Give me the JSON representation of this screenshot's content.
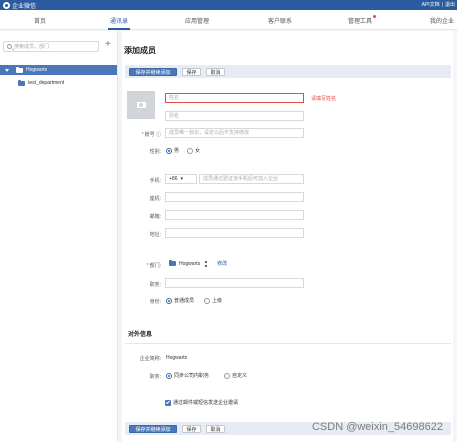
{
  "app": {
    "title": "企业微信",
    "top_links": [
      "API文档",
      "退出"
    ]
  },
  "nav": [
    {
      "label": "首页"
    },
    {
      "label": "通讯录",
      "active": true
    },
    {
      "label": "应用管理"
    },
    {
      "label": "客户联系"
    },
    {
      "label": "管理工具",
      "has_dot": true
    },
    {
      "label": "我的企业"
    }
  ],
  "sidebar": {
    "search_placeholder": "搜索成员、部门",
    "add_label": "+",
    "tree_root": "Hogwarts",
    "tree_child": "test_department"
  },
  "page_title": "添加成员",
  "actions": {
    "save_continue": "保存并继续添加",
    "save": "保存",
    "cancel": "取消"
  },
  "form": {
    "name_placeholder": "姓名",
    "name_error": "请填写姓名",
    "alias_placeholder": "别名",
    "account_label": "账号",
    "account_help": "ⓘ",
    "account_placeholder": "成员唯一标识，设定以后不支持修改",
    "gender_label": "性别:",
    "gender_male": "男",
    "gender_female": "女",
    "phone_label": "手机:",
    "phone_code": "+86",
    "phone_placeholder": "成员通过验证该手机后可加入企业",
    "tel_label": "座机:",
    "email_label": "邮箱:",
    "address_label": "地址:",
    "dept_label": "部门:",
    "dept_value": "Hogwarts",
    "dept_modify": "修改",
    "position_label": "职务:",
    "identity_label": "身份:",
    "identity_normal": "普通成员",
    "identity_leader": "上级"
  },
  "external": {
    "section_title": "对外信息",
    "corp_name_label": "企业简称:",
    "corp_name_value": "Hogwarts",
    "position_label": "职务:",
    "position_sync": "同步公司内职务",
    "position_custom": "自定义",
    "invite_checkbox": "通过邮件或短信发送企业邀请"
  },
  "watermark": "CSDN @weixin_54698622"
}
